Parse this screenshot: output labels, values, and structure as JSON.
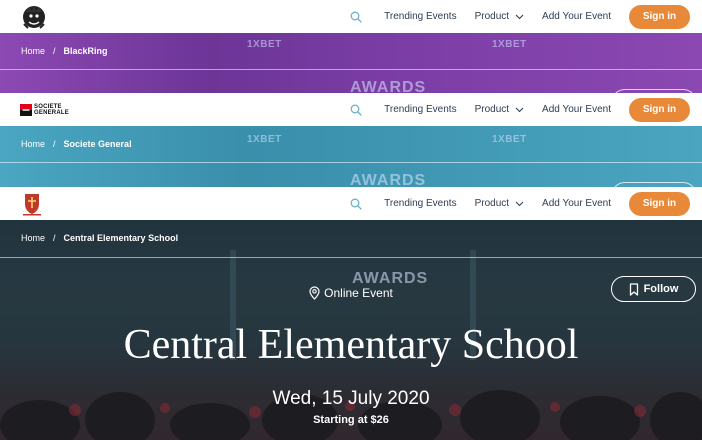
{
  "colors": {
    "accent": "#e8893a",
    "nav_text": "#2c3e50",
    "banner_purple": "#7f3fa8",
    "banner_teal": "#3a8fab",
    "hero_dark": "#23333c"
  },
  "icons": {
    "search": "search-icon",
    "chevron": "chevron-down-icon",
    "location": "location-pin-icon",
    "bookmark": "bookmark-icon"
  },
  "navbars": [
    {
      "links": {
        "trending": "Trending Events",
        "product": "Product",
        "add_event": "Add Your Event"
      },
      "signin": "Sign in"
    },
    {
      "logo_text_line1": "SOCIETE",
      "logo_text_line2": "GENERALE",
      "links": {
        "trending": "Trending Events",
        "product": "Product",
        "add_event": "Add Your Event"
      },
      "signin": "Sign in"
    },
    {
      "links": {
        "trending": "Trending Events",
        "product": "Product",
        "add_event": "Add Your Event"
      },
      "signin": "Sign in"
    }
  ],
  "banners": [
    {
      "breadcrumb": {
        "home": "Home",
        "separator": "/",
        "current": "BlackRing"
      }
    },
    {
      "breadcrumb": {
        "home": "Home",
        "separator": "/",
        "current": "Societe General"
      }
    },
    {
      "breadcrumb": {
        "home": "Home",
        "separator": "/",
        "current": "Central Elementary School"
      }
    }
  ],
  "stage": {
    "brand_word": "1XBET",
    "awards_word": "AWARDS"
  },
  "event": {
    "type_label": "Online Event",
    "title": "Central Elementary School",
    "date": "Wed, 15 July 2020",
    "price": "Starting at $26",
    "follow_label": "Follow"
  }
}
